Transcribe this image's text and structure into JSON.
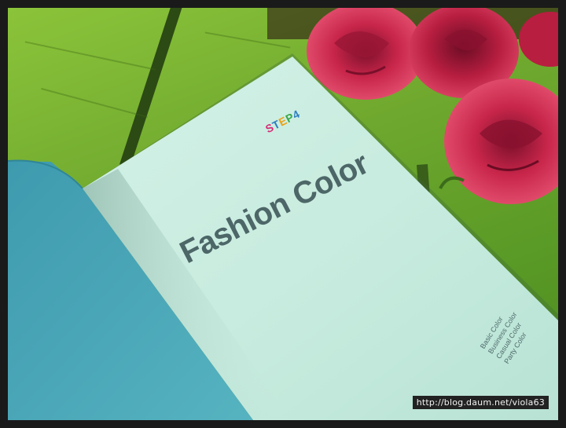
{
  "book": {
    "step_letters": [
      "S",
      "T",
      "E",
      "P",
      "4"
    ],
    "step_colors": [
      "#d62e7a",
      "#2f7fc1",
      "#e8a21a",
      "#3aa64a",
      "#2f7fc1"
    ],
    "title": "Fashion Color",
    "contents": [
      "Basic Color",
      "Business Color",
      "Casual Color",
      "Party Color"
    ]
  },
  "watermark": "http://blog.daum.net/viola63",
  "colors": {
    "table_green": "#6fa82e",
    "page_mint": "#c9ece0",
    "cover_teal": "#4aa6b6",
    "rose_red": "#c8264a",
    "frame": "#1a1a1a"
  }
}
